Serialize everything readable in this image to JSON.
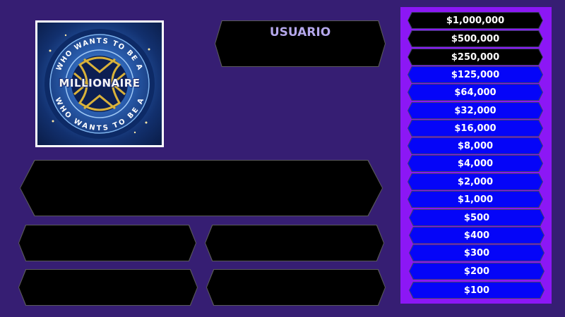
{
  "logo": {
    "arc_top_text": "WHO WANTS TO BE A",
    "word": "MILLIONAIRE",
    "arc_bottom_text": "WHO WANTS TO BE A"
  },
  "player": {
    "name": "USUARIO"
  },
  "question": {
    "text": ""
  },
  "answers": {
    "a": "",
    "b": "",
    "c": "",
    "d": ""
  },
  "ladder": {
    "rungs": [
      {
        "amount": "$1,000,000",
        "style": "black"
      },
      {
        "amount": "$500,000",
        "style": "black"
      },
      {
        "amount": "$250,000",
        "style": "black"
      },
      {
        "amount": "$125,000",
        "style": "blue"
      },
      {
        "amount": "$64,000",
        "style": "blue"
      },
      {
        "amount": "$32,000",
        "style": "blue"
      },
      {
        "amount": "$16,000",
        "style": "blue"
      },
      {
        "amount": "$8,000",
        "style": "blue"
      },
      {
        "amount": "$4,000",
        "style": "blue"
      },
      {
        "amount": "$2,000",
        "style": "blue"
      },
      {
        "amount": "$1,000",
        "style": "blue"
      },
      {
        "amount": "$500",
        "style": "blue"
      },
      {
        "amount": "$400",
        "style": "blue"
      },
      {
        "amount": "$300",
        "style": "blue"
      },
      {
        "amount": "$200",
        "style": "blue"
      },
      {
        "amount": "$100",
        "style": "blue"
      }
    ]
  },
  "colors": {
    "background": "#361e73",
    "ladder_panel": "#8c17f5",
    "rung_blue": "#0505f8",
    "rung_black": "#000000",
    "user_label": "#b4a7ea"
  }
}
